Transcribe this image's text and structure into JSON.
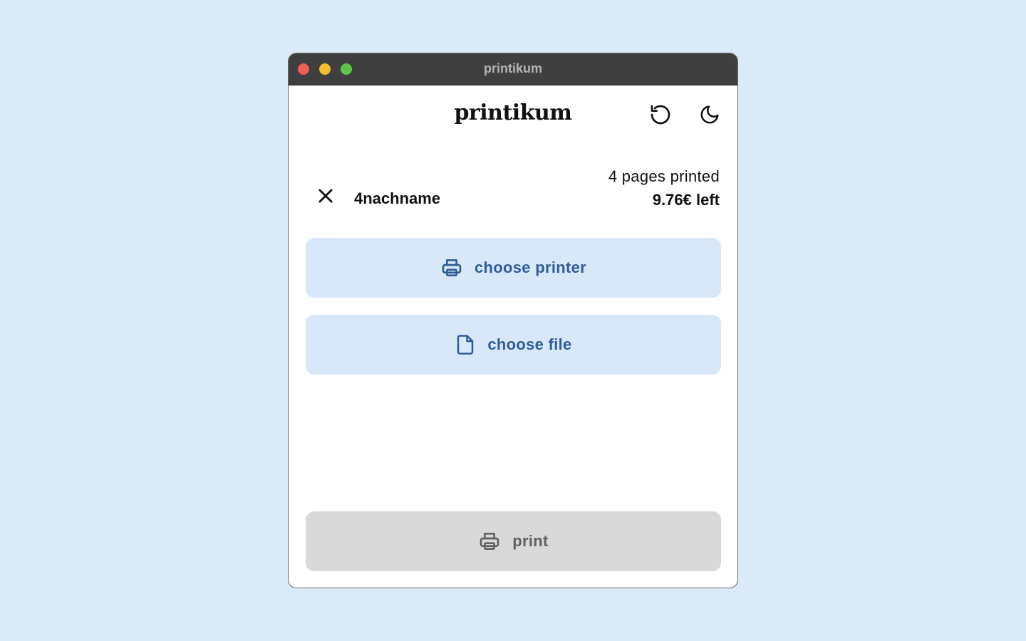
{
  "window": {
    "title": "printikum"
  },
  "app": {
    "title": "printikum"
  },
  "header": {
    "reload_icon": "rotate-ccw-icon",
    "theme_icon": "moon-icon"
  },
  "user": {
    "name": "4nachname",
    "pages_printed": "4 pages printed",
    "credit_left": "9.76€ left",
    "logout_icon": "close-icon"
  },
  "actions": {
    "choose_printer": "choose printer",
    "choose_file": "choose file",
    "print": "print"
  },
  "colors": {
    "background": "#dbeaf9",
    "primary_button_bg": "#d8e8f9",
    "primary_button_text": "#2f5d97",
    "disabled_button_bg": "#d9d9d9",
    "disabled_button_text": "#616161"
  }
}
